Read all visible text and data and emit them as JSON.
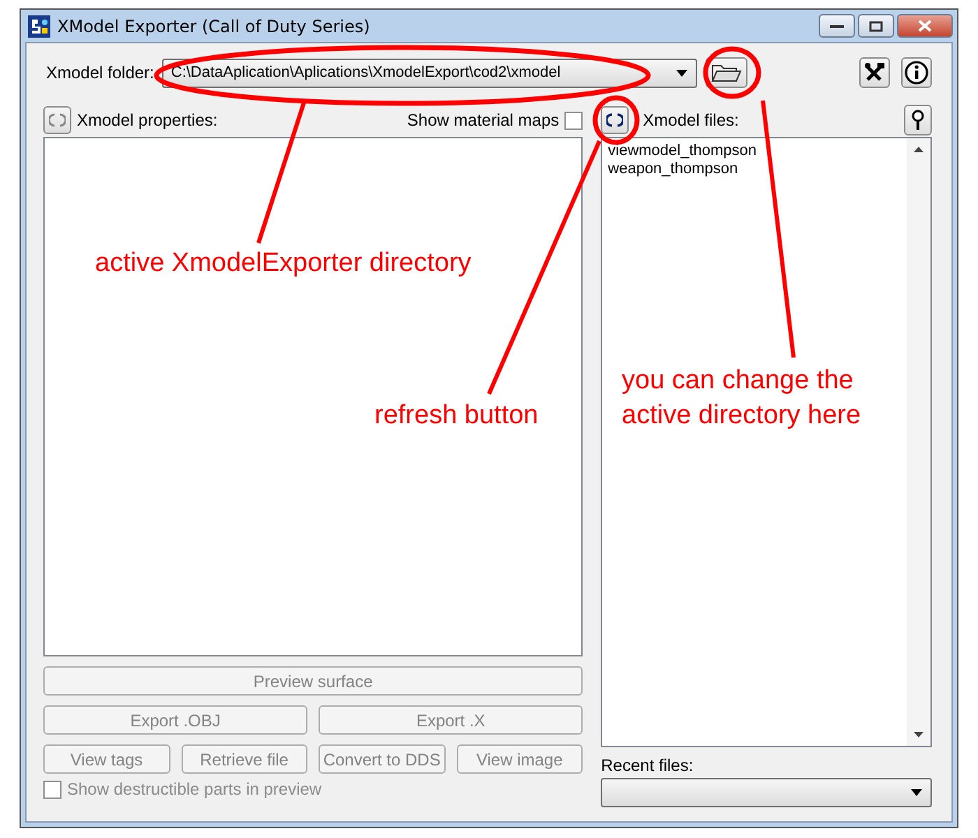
{
  "window": {
    "title": "XModel Exporter (Call of Duty Series)"
  },
  "folder": {
    "label": "Xmodel folder:",
    "value": "C:\\DataAplication\\Aplications\\XmodelExport\\cod2\\xmodel"
  },
  "properties": {
    "label": "Xmodel properties:"
  },
  "show_material_maps": {
    "label": "Show material maps",
    "checked": false
  },
  "files": {
    "label": "Xmodel files:",
    "items": [
      "viewmodel_thompson",
      "weapon_thompson"
    ]
  },
  "button_rows": [
    [
      {
        "label": "Preview surface",
        "disabled": true
      }
    ],
    [
      {
        "label": "Export .OBJ",
        "disabled": true
      },
      {
        "label": "Export .X",
        "disabled": true
      }
    ],
    [
      {
        "label": "View tags",
        "disabled": true
      },
      {
        "label": "Retrieve file",
        "disabled": true
      },
      {
        "label": "Convert to DDS",
        "disabled": true
      },
      {
        "label": "View image",
        "disabled": true
      }
    ]
  ],
  "destructible": {
    "label": "Show destructible parts in preview",
    "checked": false,
    "disabled": true
  },
  "recent_files": {
    "label": "Recent files:"
  },
  "annotations": [
    {
      "text": "active XmodelExporter directory"
    },
    {
      "text": "refresh button"
    },
    {
      "text": "you can change the active directory here"
    }
  ]
}
